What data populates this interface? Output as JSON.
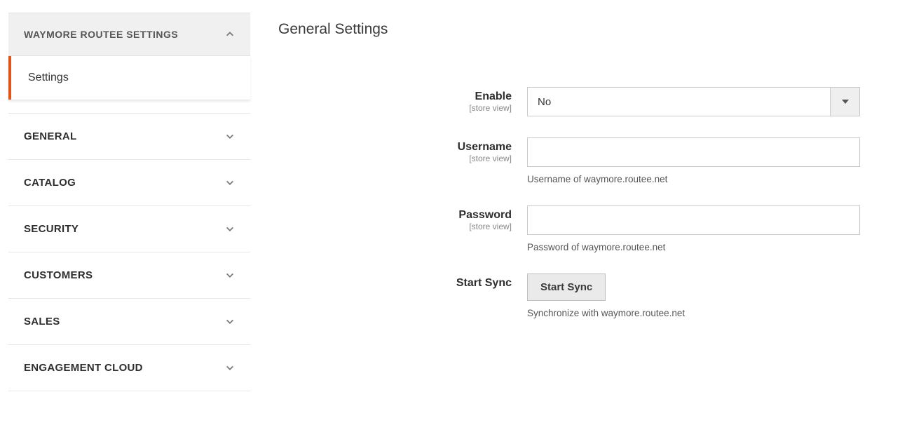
{
  "sidebar": {
    "expanded": {
      "label": "WAYMORE ROUTEE SETTINGS",
      "subitems": [
        {
          "label": "Settings"
        }
      ]
    },
    "sections": [
      {
        "label": "GENERAL"
      },
      {
        "label": "CATALOG"
      },
      {
        "label": "SECURITY"
      },
      {
        "label": "CUSTOMERS"
      },
      {
        "label": "SALES"
      },
      {
        "label": "ENGAGEMENT CLOUD"
      }
    ]
  },
  "page": {
    "title": "General Settings"
  },
  "form": {
    "scope_label": "[store view]",
    "enable": {
      "label": "Enable",
      "value": "No"
    },
    "username": {
      "label": "Username",
      "value": "",
      "help": "Username of waymore.routee.net"
    },
    "password": {
      "label": "Password",
      "value": "",
      "help": "Password of waymore.routee.net"
    },
    "start_sync": {
      "label": "Start Sync",
      "button": "Start Sync",
      "help": "Synchronize with waymore.routee.net"
    }
  }
}
